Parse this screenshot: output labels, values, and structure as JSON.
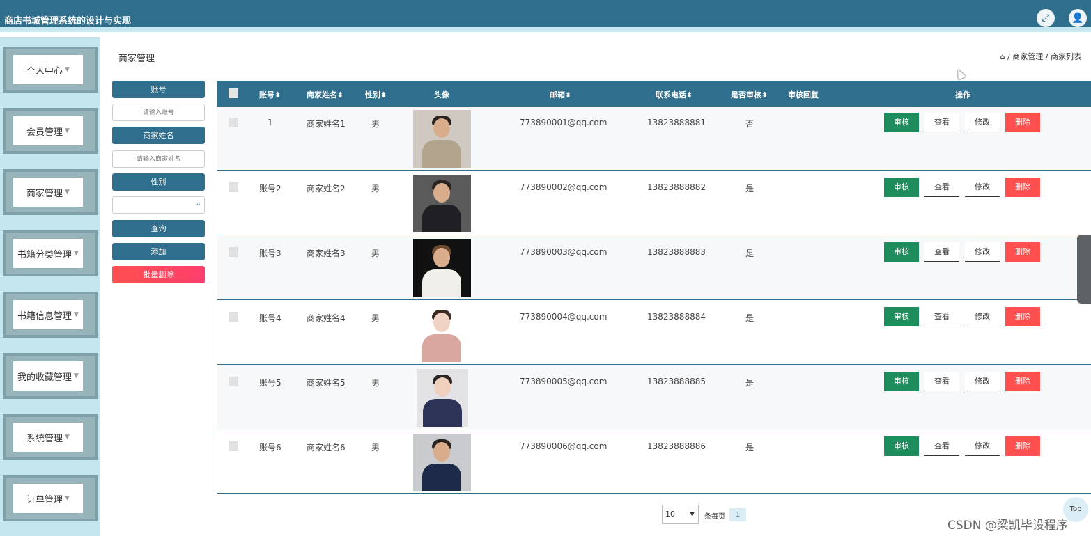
{
  "app": {
    "title": "商店书城管理系统的设计与实现",
    "fullscreen_icon": "fullscreen-icon",
    "user_icon": "user-icon",
    "header_color": "#2f6f8d"
  },
  "sidebar": {
    "items": [
      {
        "label": "个人中心"
      },
      {
        "label": "会员管理"
      },
      {
        "label": "商家管理"
      },
      {
        "label": "书籍分类管理"
      },
      {
        "label": "书籍信息管理"
      },
      {
        "label": "我的收藏管理"
      },
      {
        "label": "系统管理"
      },
      {
        "label": "订单管理"
      }
    ]
  },
  "page": {
    "title": "商家管理",
    "breadcrumb": [
      "商家管理",
      "商家列表"
    ]
  },
  "search": {
    "account_label": "账号",
    "account_placeholder": "请输入账号",
    "name_label": "商家姓名",
    "name_placeholder": "请输入商家姓名",
    "gender_label": "性别",
    "gender_value": "",
    "query_button": "查询",
    "add_button": "添加",
    "batch_delete_button": "批量删除"
  },
  "table": {
    "headers": [
      "账号",
      "商家姓名",
      "性别",
      "头像",
      "邮箱",
      "联系电话",
      "是否审核",
      "审核回复",
      "操作"
    ],
    "rows": [
      {
        "account": "1",
        "name": "商家姓名1",
        "gender": "男",
        "email": "773890001@qq.com",
        "phone": "13823888881",
        "audited": "否",
        "reply": ""
      },
      {
        "account": "账号2",
        "name": "商家姓名2",
        "gender": "男",
        "email": "773890002@qq.com",
        "phone": "13823888882",
        "audited": "是",
        "reply": ""
      },
      {
        "account": "账号3",
        "name": "商家姓名3",
        "gender": "男",
        "email": "773890003@qq.com",
        "phone": "13823888883",
        "audited": "是",
        "reply": ""
      },
      {
        "account": "账号4",
        "name": "商家姓名4",
        "gender": "男",
        "email": "773890004@qq.com",
        "phone": "13823888884",
        "audited": "是",
        "reply": ""
      },
      {
        "account": "账号5",
        "name": "商家姓名5",
        "gender": "男",
        "email": "773890005@qq.com",
        "phone": "13823888885",
        "audited": "是",
        "reply": ""
      },
      {
        "account": "账号6",
        "name": "商家姓名6",
        "gender": "男",
        "email": "773890006@qq.com",
        "phone": "13823888886",
        "audited": "是",
        "reply": ""
      }
    ],
    "actions": {
      "audit": "审核",
      "view": "查看",
      "edit": "修改",
      "delete": "删除"
    }
  },
  "pagination": {
    "page_size": "10",
    "per_page_label": "条每页",
    "current_page": "1"
  },
  "back_to_top": "Top",
  "watermark": "CSDN @梁凯毕设程序"
}
